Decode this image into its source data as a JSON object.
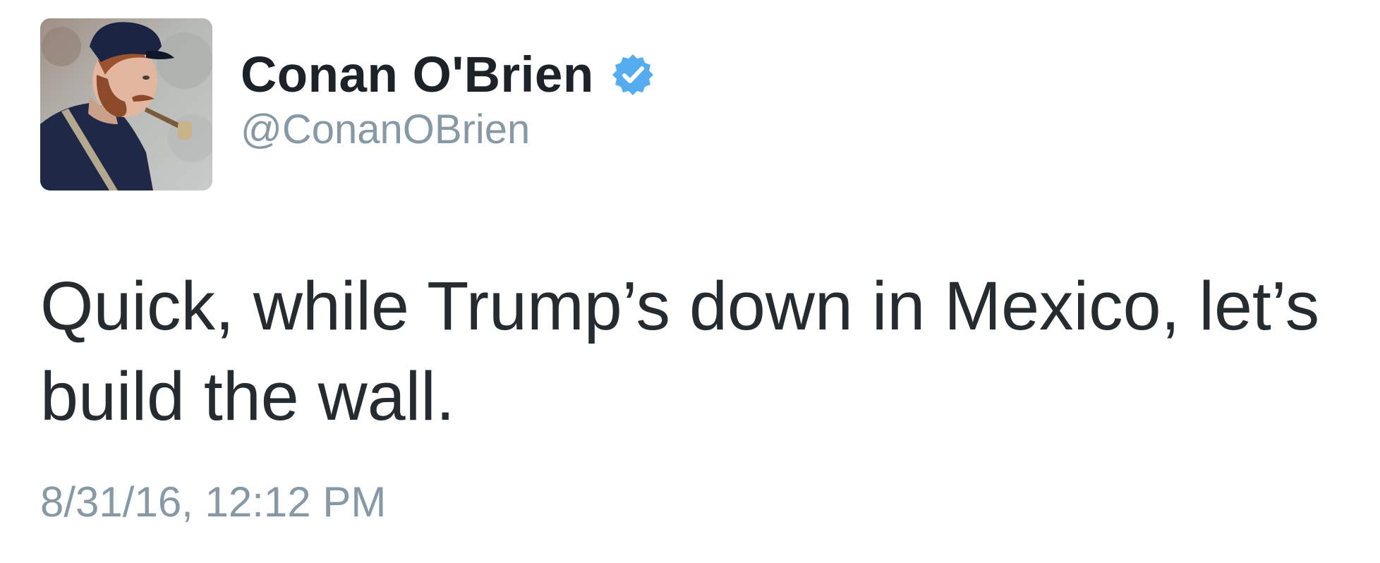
{
  "author": {
    "display_name": "Conan O'Brien",
    "handle": "@ConanOBrien",
    "verified": true,
    "avatar_icon": "profile-photo-union-soldier-with-pipe",
    "verified_icon": "verified-badge-icon"
  },
  "tweet": {
    "text": "Quick, while Trump’s down in Mexico, let’s build the wall.",
    "timestamp": "8/31/16, 12:12 PM"
  },
  "colors": {
    "background": "#ffffff",
    "name_text": "#1c2227",
    "body_text": "#262b2f",
    "secondary_text": "#8899a6",
    "verified_blue": "#55acee"
  }
}
